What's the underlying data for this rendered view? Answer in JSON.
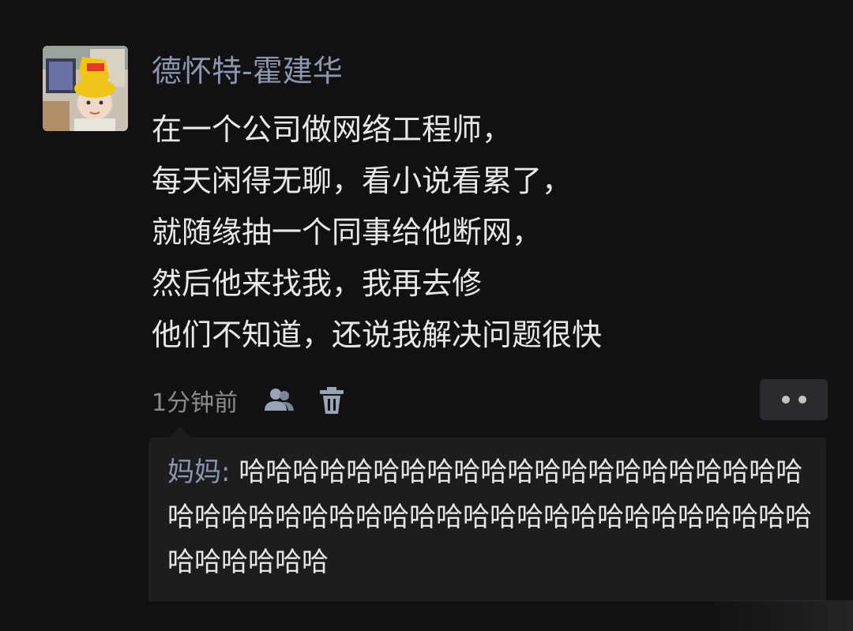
{
  "post": {
    "author": "德怀特-霍建华",
    "lines": [
      "在一个公司做网络工程师，",
      "每天闲得无聊，看小说看累了，",
      "就随缘抽一个同事给他断网，",
      "然后他来找我，我再去修",
      "他们不知道，还说我解决问题很快"
    ],
    "time": "1分钟前",
    "visibility_icon": "friends-icon",
    "delete_icon": "trash-icon",
    "more_icon": "more-dots-icon"
  },
  "comment": {
    "author": "妈妈",
    "separator": ": ",
    "text": "哈哈哈哈哈哈哈哈哈哈哈哈哈哈哈哈哈哈哈哈哈哈哈哈哈哈哈哈哈哈哈哈哈哈哈哈哈哈哈哈哈哈哈哈哈哈哈哈哈哈哈"
  },
  "colors": {
    "background": "#111113",
    "author": "#8c96ac",
    "text": "#e8e8e8",
    "meta": "#8b8b8b",
    "comment_bg": "#1d1d20"
  }
}
